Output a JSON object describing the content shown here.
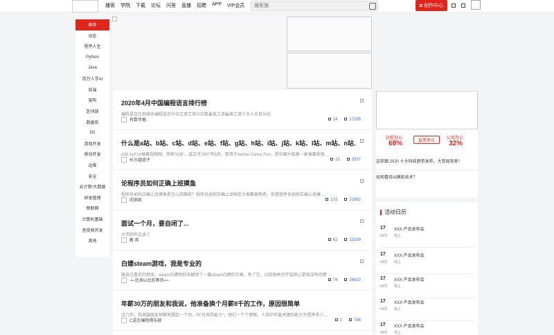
{
  "nav": [
    "播客",
    "学院",
    "下载",
    "论坛",
    "问答",
    "直播",
    "招聘",
    "APP",
    "VIP会员"
  ],
  "search": {
    "placeholder": "搜索搜"
  },
  "creator_button": "创作中心",
  "sidebar": [
    "推荐",
    "动态",
    "程序人生",
    "Python",
    "Java",
    "百万人学AI",
    "前端",
    "架构",
    "区块链",
    "数据库",
    "5G",
    "游戏开发",
    "移动开发",
    "运维",
    "安全",
    "云计算/大数据",
    "研发管理",
    "物联网",
    "计算机基础",
    "音视频开发",
    "其他"
  ],
  "articles": [
    {
      "title": "2020年4月中国编程语言排行榜",
      "summary": "编程语言比例排名编程语言中均工资工资中位数最低工资最高工资人头人头百分比",
      "author": "有数可据",
      "comments": "14",
      "views": "17295"
    },
    {
      "title": "什么是a站、b站、c站、d站、e站、f站、g站、h站、i站、j站、k站、l站、m站、n站……",
      "summary": "A站 AcFun弹幕视频网，简称\"A站\"，成立于2007年6月，取意于Anime Comic Fun，是中国大陆第一家弹幕视频…",
      "author": "长沙越道子",
      "comments": "13",
      "views": "3537"
    },
    {
      "title": "论程序员如何正确上班摸鱼",
      "summary": "程序员如何正确上班摸鱼是怎么回事呢？程序员如何正确上班相信大家都很熟悉，但是程序员如何正确上班摸…",
      "author": "闵测凯",
      "comments": "103",
      "views": "31862"
    },
    {
      "title": "面试一个月，要自闭了...",
      "summary": "大学四年白读了",
      "author": "教 芮",
      "comments": "62",
      "views": "13189"
    },
    {
      "title": "白嫖steam游戏，我是专业的",
      "summary": "做自己喜欢的爬虫，steam白嫖明的天翻领了一篇steam白嫖的文章。有了它，以后就再也不会担心游戏没有白嫖…",
      "author": "-=-北海以北的等待-=-",
      "comments": "74",
      "views": "26810"
    },
    {
      "title": "年薪30万的朋友和我说，他准备换个月薪8千的工作，原因很简单",
      "summary": "这几年，我周围朋友频繁地提起一个词，叫\"抗风险能力\"，他们一个个感慨，人到中年最关键的能力不是挣多少…",
      "author": "C语言编程俱乐部",
      "comments": "2",
      "views": "786"
    }
  ],
  "vote": {
    "left_label": "远程办公",
    "left_pct": "68%",
    "button": "投票参与",
    "right_label": "公司办公",
    "right_pct": "32%"
  },
  "right_links": [
    "这样跟 2020 十大科技趋势发布，大变局到来！",
    "如何看待AI换脸技术？"
  ],
  "calendar": {
    "title": "活动日历",
    "events": [
      {
        "day": "17",
        "month": "04月",
        "name": "XXX 产品发布会",
        "loc": "线上"
      },
      {
        "day": "17",
        "month": "04月",
        "name": "XXX 产品发布会",
        "loc": "线上"
      },
      {
        "day": "17",
        "month": "04月",
        "name": "XXX 产品发布会",
        "loc": "线上"
      },
      {
        "day": "17",
        "month": "04月",
        "name": "XXX 产品发布会",
        "loc": "线上"
      },
      {
        "day": "17",
        "month": "04月",
        "name": "XXX 产品发布会",
        "loc": "线上"
      }
    ]
  },
  "colors": {
    "accent": "#e1251b",
    "link": "#3a6fd8"
  }
}
